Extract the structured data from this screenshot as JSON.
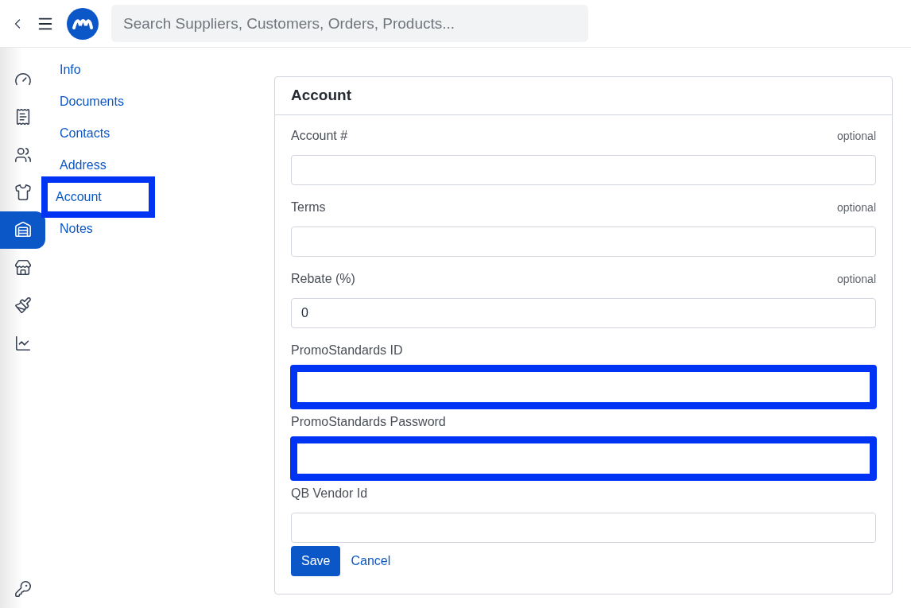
{
  "search": {
    "placeholder": "Search Suppliers, Customers, Orders, Products..."
  },
  "rail": [
    {
      "selected": false
    },
    {
      "selected": false
    },
    {
      "selected": false
    },
    {
      "selected": false
    },
    {
      "selected": true
    },
    {
      "selected": false
    },
    {
      "selected": false
    },
    {
      "selected": false
    },
    {
      "selected": false
    }
  ],
  "nav": [
    {
      "label": "Info",
      "highlighted": false
    },
    {
      "label": "Documents",
      "highlighted": false
    },
    {
      "label": "Contacts",
      "highlighted": false
    },
    {
      "label": "Address",
      "highlighted": false
    },
    {
      "label": "Account",
      "highlighted": true
    },
    {
      "label": "Notes",
      "highlighted": false
    }
  ],
  "card": {
    "title": "Account",
    "fields": [
      {
        "label": "Account #",
        "hint": "optional",
        "highlighted": false
      },
      {
        "label": "Terms",
        "hint": "optional",
        "highlighted": false
      },
      {
        "label": "Rebate (%)",
        "hint": "optional",
        "value": "0",
        "highlighted": false
      },
      {
        "label": "PromoStandards ID",
        "highlighted": true
      },
      {
        "label": "PromoStandards Password",
        "highlighted": true
      },
      {
        "label": "QB Vendor Id",
        "highlighted": false
      }
    ],
    "save": "Save",
    "cancel": "Cancel"
  }
}
